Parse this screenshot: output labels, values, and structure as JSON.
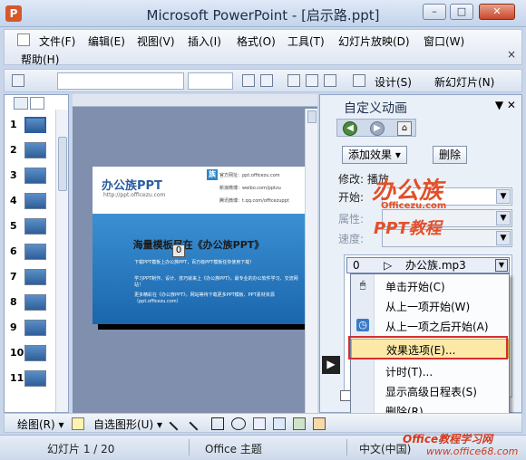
{
  "window": {
    "title": "Microsoft PowerPoint - [启示路.ppt]",
    "icon_glyph": "P",
    "minimize": "–",
    "maximize": "□",
    "close": "✕"
  },
  "menubar": {
    "items": [
      "文件(F)",
      "编辑(E)",
      "视图(V)",
      "插入(I)",
      "格式(O)",
      "工具(T)",
      "幻灯片放映(D)",
      "窗口(W)"
    ],
    "help": "帮助(H)",
    "doc_close": "×"
  },
  "toolbar": {
    "design_label": "设计(S)",
    "new_slide_label": "新幻灯片(N)"
  },
  "thumbnails": {
    "numbers": [
      "1",
      "2",
      "3",
      "4",
      "5",
      "6",
      "7",
      "8",
      "9",
      "10",
      "11"
    ],
    "selected": "1"
  },
  "slide": {
    "logo": "办公族PPT",
    "url": "http://ppt.officezu.com",
    "badge": "族",
    "info_lines": [
      "官方网址：ppt.officezu.com",
      "新浪微博：weibo.com/pptzu",
      "腾讯微博：t.qq.com/officezuppt"
    ],
    "heading": "海量模板尽在《办公族PPT》",
    "bullets": [
      "下载PPT模板上办公族PPT，百万级PPT模板任你使用下载！",
      "学习PPT制作、设计、技巧就来上《办公族PPT》，最专业的办公软件学习、交流网站！",
      "更多精彩在《办公族PPT》，网站等待下载更多PPT模板、PPT素材资源（ppt.officezu.com）"
    ],
    "anim_tag": "0"
  },
  "taskpane": {
    "title": "自定义动画",
    "close_glyph": "▼ ✕",
    "back_glyph": "◀",
    "forward_glyph": "▶",
    "home_glyph": "⌂",
    "add_effect_label": "添加效果 ▾",
    "delete_label": "删除",
    "modify_label": "修改: 播放",
    "start_label": "开始:",
    "property_label": "属性:",
    "speed_label": "速度:",
    "anim_item": {
      "index": "0",
      "play_glyph": "▷",
      "name": "办公族.mp3"
    },
    "reorder_glyph": "▶",
    "play_check": "✓"
  },
  "context_menu": {
    "items": [
      {
        "label": "单击开始(C)",
        "icon": "mouse-icon",
        "glyph": "🖱"
      },
      {
        "label": "从上一项开始(W)",
        "icon": "",
        "glyph": ""
      },
      {
        "label": "从上一项之后开始(A)",
        "icon": "clock-icon",
        "glyph": "◷"
      },
      {
        "label": "效果选项(E)...",
        "icon": "",
        "glyph": ""
      },
      {
        "label": "计时(T)...",
        "icon": "",
        "glyph": ""
      },
      {
        "label": "显示高级日程表(S)",
        "icon": "",
        "glyph": ""
      },
      {
        "label": "删除(R)",
        "icon": "",
        "glyph": ""
      }
    ],
    "highlighted": "效果选项(E)..."
  },
  "watermark": {
    "main": "办公族",
    "sub": "Officezu.com",
    "ppt": "PPT教程",
    "bottom": "Office教程学习网",
    "bottom_url": "www.office68.com"
  },
  "drawbar": {
    "draw_label": "绘图(R) ▾",
    "autoshape_label": "自选图形(U) ▾"
  },
  "statusbar": {
    "slide_info": "幻灯片 1 / 20",
    "theme": "Office 主题",
    "language": "中文(中国)"
  }
}
